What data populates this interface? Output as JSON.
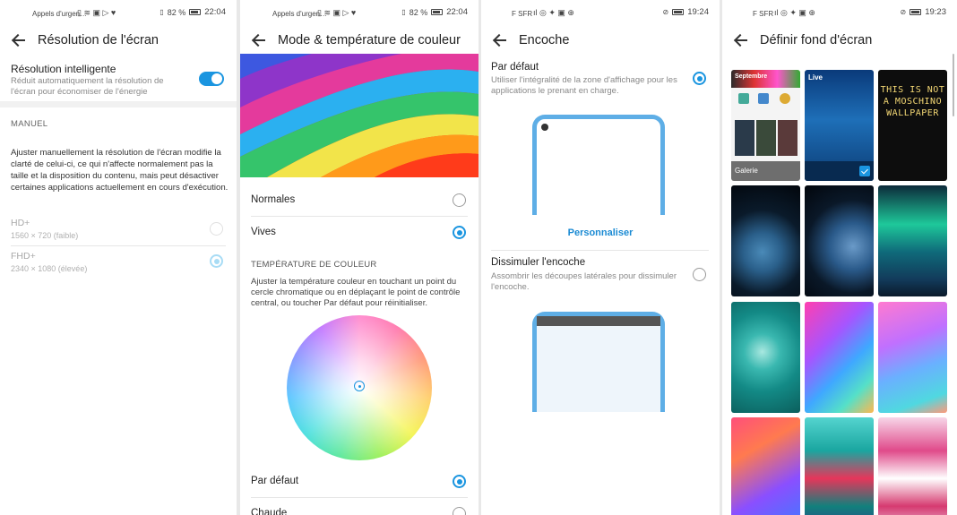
{
  "panel1": {
    "status_left": "Appels d'urgen…",
    "status_battery": "82 %",
    "status_time": "22:04",
    "title": "Résolution de l'écran",
    "smart": {
      "label": "Résolution intelligente",
      "description": "Réduit automatiquement la résolution de l'écran pour économiser de l'énergie",
      "enabled": true
    },
    "section": "MANUEL",
    "paragraph": "Ajuster manuellement la résolution de l'écran modifie la clarté de celui-ci, ce qui n'affecte normalement pas la taille et la disposition du contenu, mais peut désactiver certaines applications actuellement en cours d'exécution.",
    "options": [
      {
        "label": "HD+",
        "sub": "1560 × 720 (faible)",
        "selected": false
      },
      {
        "label": "FHD+",
        "sub": "2340 × 1080 (élevée)",
        "selected": true
      }
    ]
  },
  "panel2": {
    "status_left": "Appels d'urgen…",
    "status_battery": "82 %",
    "status_time": "22:04",
    "title": "Mode & température de couleur",
    "modes": [
      {
        "label": "Normales",
        "selected": false
      },
      {
        "label": "Vives",
        "selected": true
      }
    ],
    "section": "TEMPÉRATURE DE COULEUR",
    "paragraph": "Ajuster la température couleur en touchant un point du cercle chromatique ou en déplaçant le point de contrôle central, ou toucher Par défaut pour réinitialiser.",
    "temps": [
      {
        "label": "Par défaut",
        "selected": true
      },
      {
        "label": "Chaude",
        "selected": false
      }
    ]
  },
  "panel3": {
    "status_left": "F SFR",
    "status_time": "19:24",
    "title": "Encoche",
    "default": {
      "label": "Par défaut",
      "description": "Utiliser l'intégralité de la zone d'affichage pour les applications le prenant en charge.",
      "selected": true
    },
    "customize_link": "Personnaliser",
    "hide": {
      "label": "Dissimuler l'encoche",
      "description": "Assombrir les découpes latérales pour dissimuler l'encoche.",
      "selected": false
    }
  },
  "panel4": {
    "status_left": "F SFR",
    "status_time": "19:23",
    "title": "Définir fond d'écran",
    "gallery_label": "Galerie",
    "live_label": "Live",
    "moschino_text": "THIS IS NOT A MOSCHINO WALLPAPER",
    "gallery_header": "Septembre"
  }
}
